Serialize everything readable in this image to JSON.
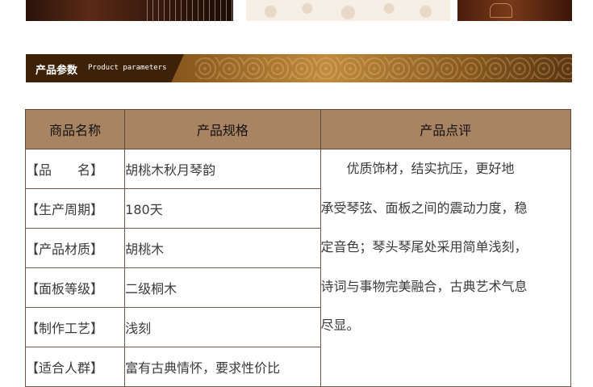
{
  "banner": {
    "title_cn": "产品参数",
    "title_en": "Product parameters"
  },
  "table": {
    "headers": [
      "商品名称",
      "产品规格",
      "产品点评"
    ],
    "rows": [
      {
        "label": "【品　　名】",
        "value": "胡桃木秋月琴韵"
      },
      {
        "label": "【生产周期】",
        "value": "180天"
      },
      {
        "label": "【产品材质】",
        "value": "胡桃木"
      },
      {
        "label": "【面板等级】",
        "value": "二级桐木"
      },
      {
        "label": "【制作工艺】",
        "value": "浅刻"
      },
      {
        "label": "【适合人群】",
        "value": "富有古典情怀，要求性价比"
      }
    ],
    "comment_lines": [
      "优质饰材，结实抗压，更好地",
      "承受琴弦、面板之间的震动力度，稳",
      "定音色；琴头琴尾处采用简单浅刻，",
      "诗词与事物完美融合，古典艺术气息",
      "尽显。"
    ]
  }
}
